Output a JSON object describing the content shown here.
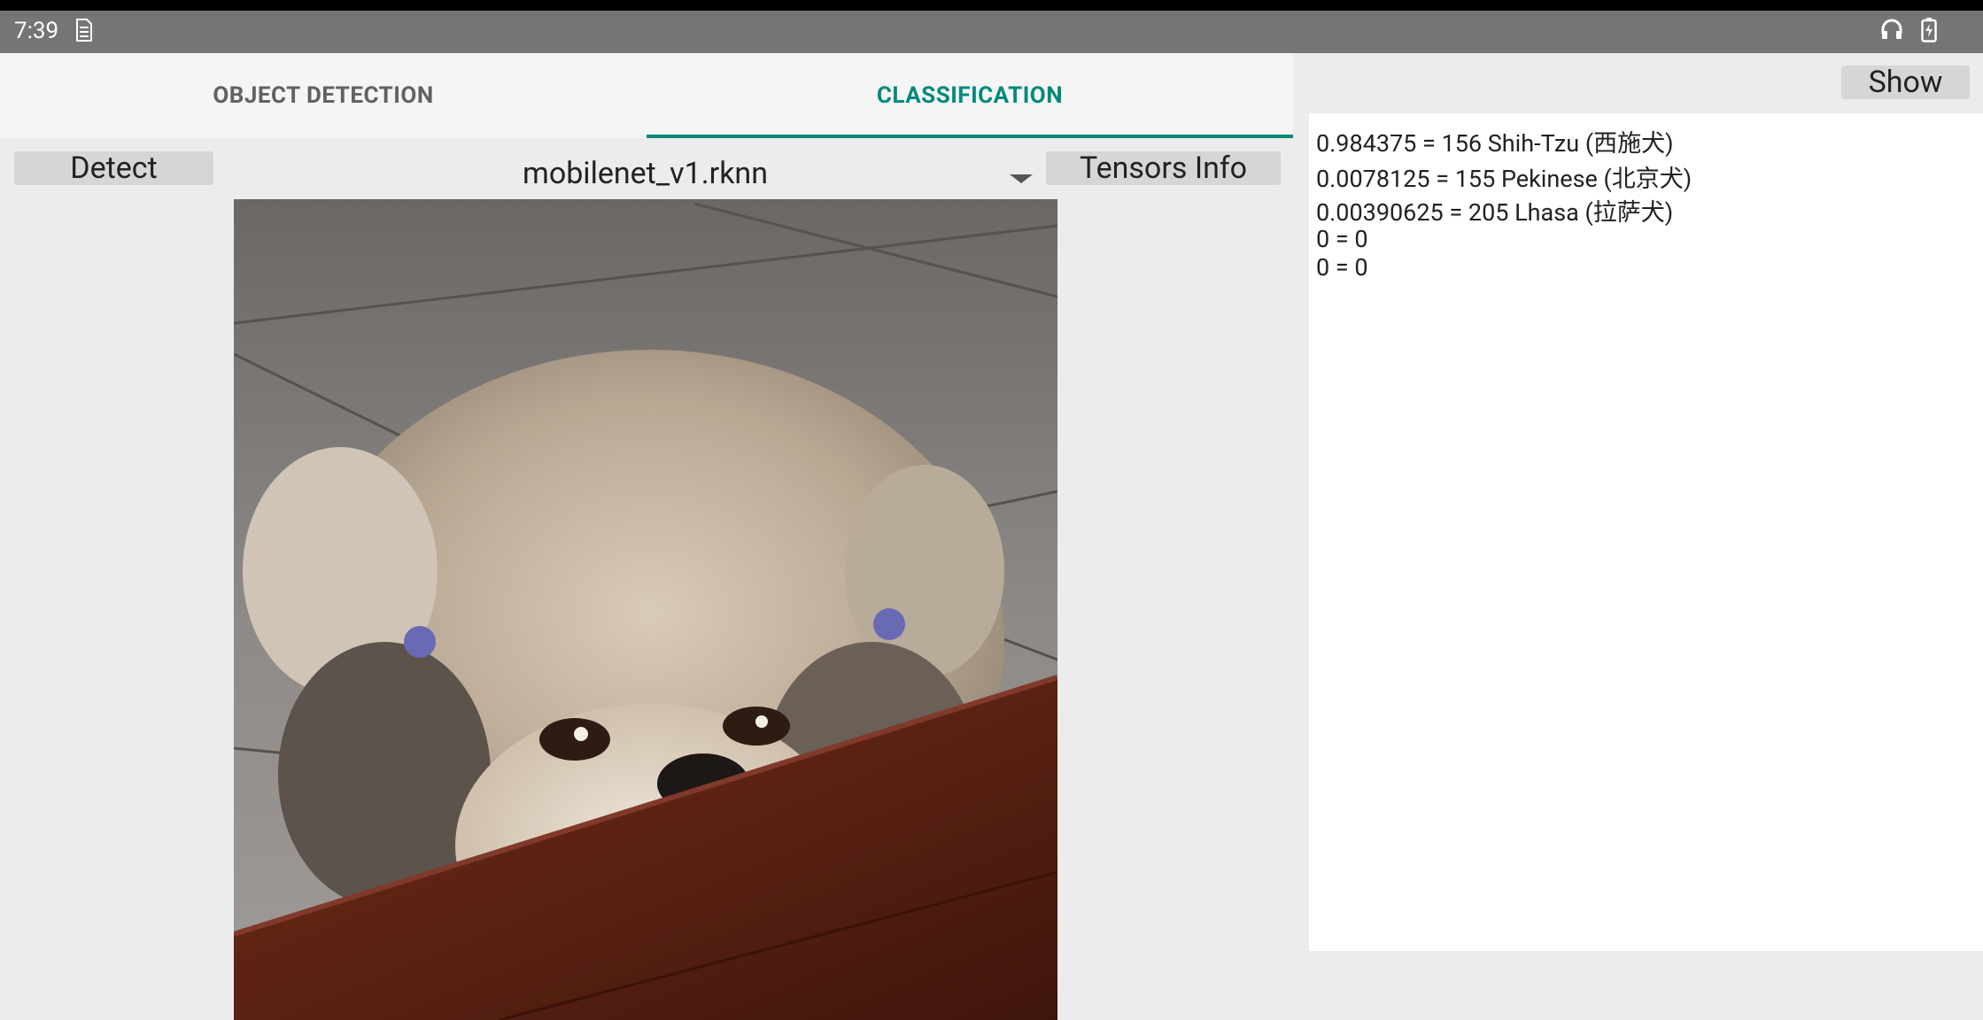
{
  "status_bar": {
    "time": "7:39",
    "sim_icon": "sim-icon",
    "headset_icon": "headset-icon",
    "battery_icon": "battery-charging-icon"
  },
  "tabs": [
    {
      "label": "OBJECT DETECTION",
      "selected": false
    },
    {
      "label": "CLASSIFICATION",
      "selected": true
    }
  ],
  "toolbar": {
    "detect_label": "Detect",
    "model_selected": "mobilenet_v1.rknn",
    "tensors_info_label": "Tensors Info",
    "show_label": "Show"
  },
  "results": [
    "0.984375 = 156 Shih-Tzu (西施犬)",
    "0.0078125 = 155 Pekinese (北京犬)",
    "0.00390625 = 205 Lhasa (拉萨犬)",
    "0 = 0",
    "0 = 0"
  ],
  "colors": {
    "accent": "#00897b",
    "status_bar": "#757575",
    "background": "#ececec"
  }
}
